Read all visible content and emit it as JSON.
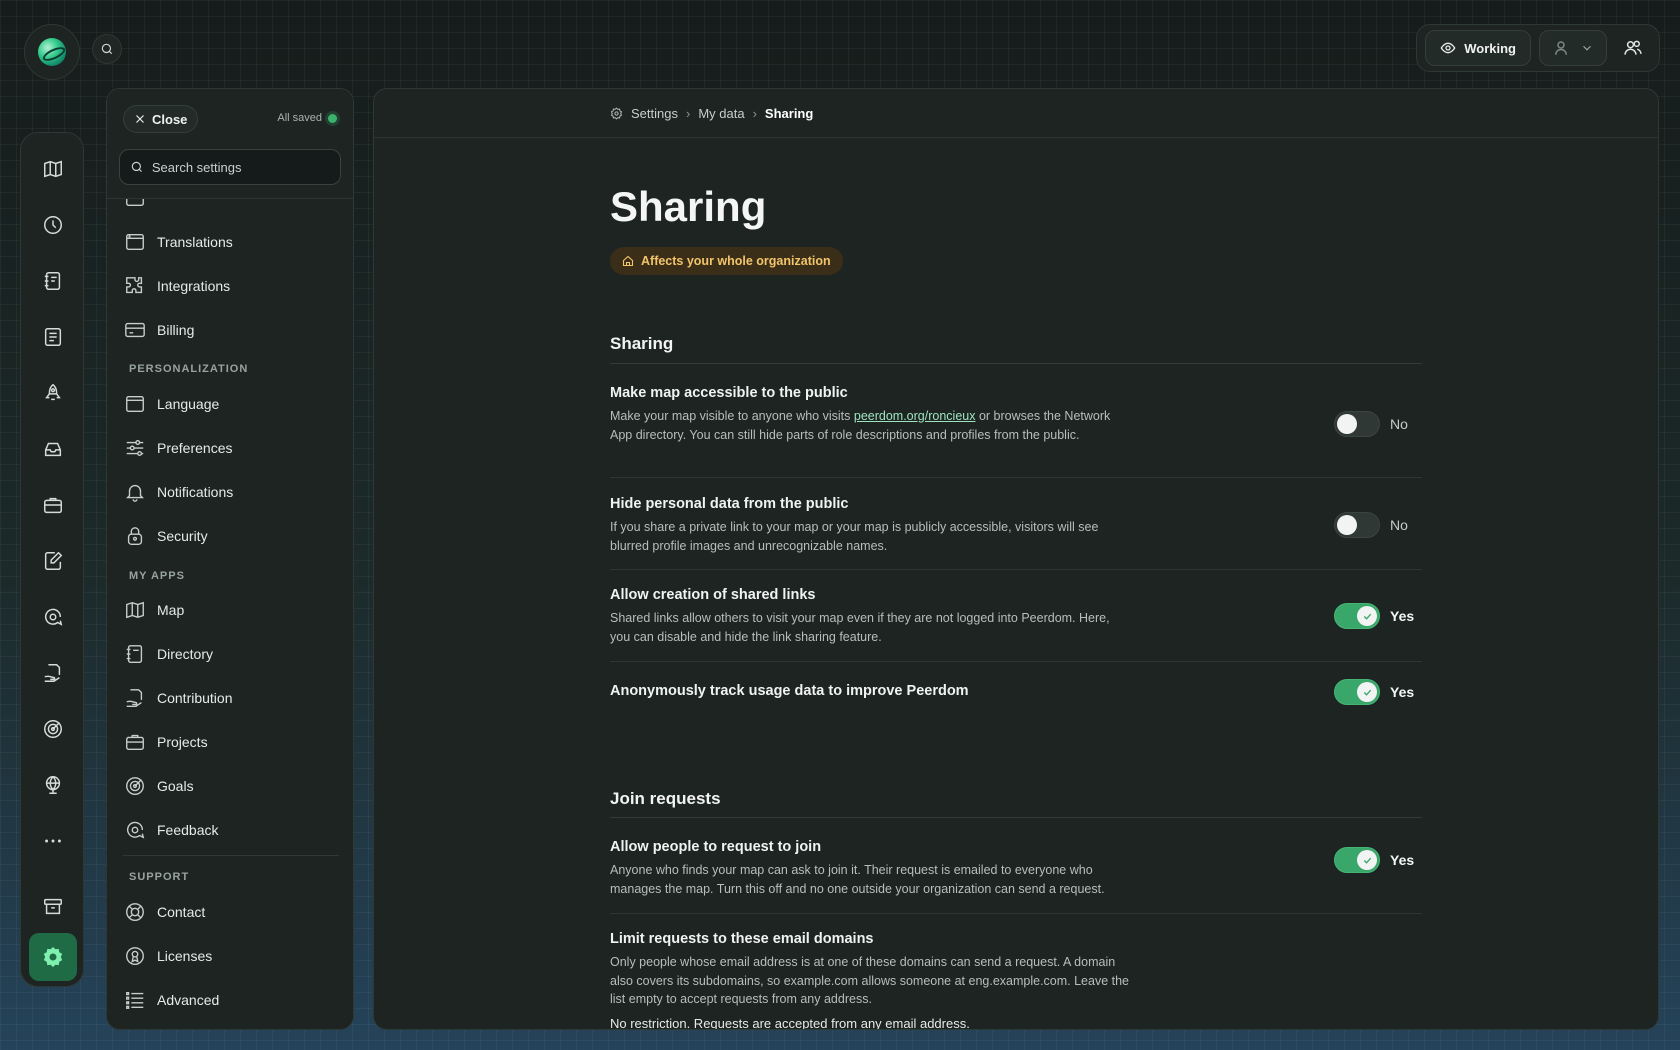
{
  "header": {
    "working_label": "Working"
  },
  "sidebar": {
    "close_label": "Close",
    "saved_label": "All saved",
    "search_placeholder": "Search settings",
    "items_top": [
      {
        "label": "Translations",
        "icon": "browser-window-icon"
      },
      {
        "label": "Integrations",
        "icon": "puzzle-icon"
      },
      {
        "label": "Billing",
        "icon": "credit-card-icon"
      }
    ],
    "personalization_title": "PERSONALIZATION",
    "personalization": [
      {
        "label": "Language",
        "icon": "browser-window-icon"
      },
      {
        "label": "Preferences",
        "icon": "sliders-icon"
      },
      {
        "label": "Notifications",
        "icon": "bell-icon"
      },
      {
        "label": "Security",
        "icon": "lock-icon"
      }
    ],
    "apps_title": "MY APPS",
    "apps": [
      {
        "label": "Map",
        "icon": "map-icon"
      },
      {
        "label": "Directory",
        "icon": "notebook-icon"
      },
      {
        "label": "Contribution",
        "icon": "hand-document-icon"
      },
      {
        "label": "Projects",
        "icon": "briefcase-icon"
      },
      {
        "label": "Goals",
        "icon": "target-icon"
      },
      {
        "label": "Feedback",
        "icon": "chat-search-icon"
      }
    ],
    "support_title": "SUPPORT",
    "support": [
      {
        "label": "Contact",
        "icon": "lifebuoy-icon"
      },
      {
        "label": "Licenses",
        "icon": "certificate-icon"
      },
      {
        "label": "Advanced",
        "icon": "list-icon"
      }
    ]
  },
  "breadcrumb": {
    "items": [
      "Settings",
      "My data",
      "Sharing"
    ]
  },
  "page": {
    "title": "Sharing",
    "badge": "Affects your whole organization",
    "sections": [
      {
        "title": "Sharing",
        "rows": [
          {
            "title": "Make map accessible to the public",
            "desc_before": "Make your map visible to anyone who visits ",
            "link": "peerdom.org/roncieux",
            "desc_after": " or browses the Network App directory. You can still hide parts of role descriptions and profiles from the public.",
            "value": "No",
            "on": false
          },
          {
            "title": "Hide personal data from the public",
            "desc": "If you share a private link to your map or your map is publicly accessible, visitors will see blurred profile images and unrecognizable names.",
            "value": "No",
            "on": false
          },
          {
            "title": "Allow creation of shared links",
            "desc": "Shared links allow others to visit your map even if they are not logged into Peerdom. Here, you can disable and hide the link sharing feature.",
            "value": "Yes",
            "on": true
          },
          {
            "title": "Anonymously track usage data to improve Peerdom",
            "value": "Yes",
            "on": true
          }
        ]
      },
      {
        "title": "Join requests",
        "rows": [
          {
            "title": "Allow people to request to join",
            "desc": "Anyone who finds your map can ask to join it. Their request is emailed to everyone who manages the map. Turn this off and no one outside your organization can send a request.",
            "value": "Yes",
            "on": true
          },
          {
            "title": "Limit requests to these email domains",
            "desc": "Only people whose email address is at one of these domains can send a request. A domain also covers its subdomains, so example.com allows someone at eng.example.com. Leave the list empty to accept requests from any address.",
            "note": "No restriction. Requests are accepted from any email address."
          }
        ]
      }
    ]
  }
}
